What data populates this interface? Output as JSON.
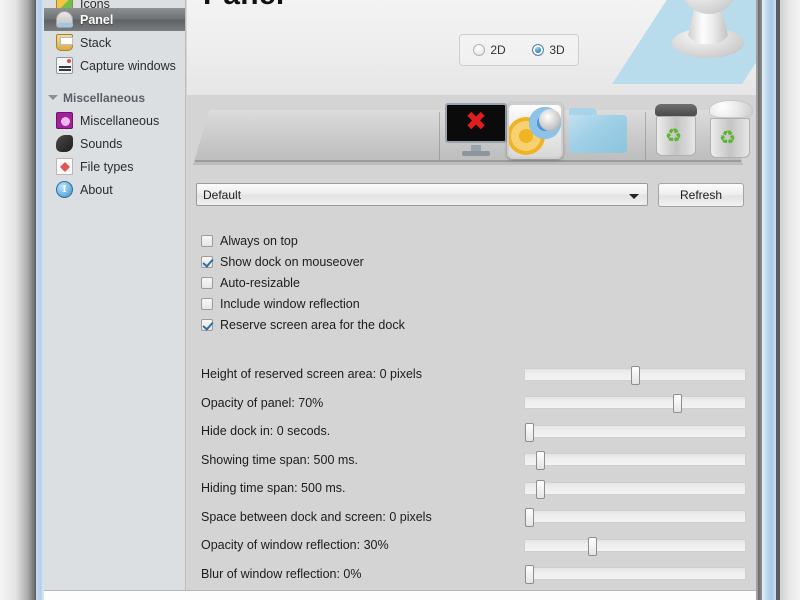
{
  "window": {
    "accent_blue": "#b3cde8",
    "client_bg": "#d4d4d4"
  },
  "sidebar": {
    "items": [
      {
        "label": "Icons",
        "icon": "icons-icon",
        "selected": false,
        "partial": true
      },
      {
        "label": "Panel",
        "icon": "panel-icon",
        "selected": true,
        "partial": false
      },
      {
        "label": "Stack",
        "icon": "stack-icon",
        "selected": false,
        "partial": false
      },
      {
        "label": "Capture windows",
        "icon": "capture-windows-icon",
        "selected": false,
        "partial": false
      }
    ],
    "group": {
      "label": "Miscellaneous",
      "icon": "chevron-down-icon"
    },
    "group_items": [
      {
        "label": "Miscellaneous",
        "icon": "miscellaneous-icon"
      },
      {
        "label": "Sounds",
        "icon": "sounds-icon"
      },
      {
        "label": "File types",
        "icon": "file-types-icon"
      },
      {
        "label": "About",
        "icon": "about-icon"
      }
    ]
  },
  "header": {
    "title": "Panel",
    "mode": {
      "options": [
        {
          "label": "2D",
          "selected": false
        },
        {
          "label": "3D",
          "selected": true
        }
      ]
    }
  },
  "preview": {
    "dock_icons": [
      {
        "name": "monitor-icon"
      },
      {
        "name": "settings-gears-icon"
      },
      {
        "name": "folder-icon"
      },
      {
        "name": "recycle-bin-empty-icon"
      },
      {
        "name": "recycle-bin-full-icon"
      },
      {
        "name": "copy-files-icon"
      },
      {
        "name": "minimize-windows-icon"
      }
    ]
  },
  "theme": {
    "selected": "Default",
    "refresh_label": "Refresh"
  },
  "checkboxes": [
    {
      "label": "Always on top",
      "checked": false
    },
    {
      "label": "Show dock on mouseover",
      "checked": true
    },
    {
      "label": "Auto-resizable",
      "checked": false
    },
    {
      "label": "Include window reflection",
      "checked": false
    },
    {
      "label": "Reserve screen area for the dock",
      "checked": true
    }
  ],
  "sliders": [
    {
      "label": "Height of reserved screen area: 0 pixels",
      "percent": 50
    },
    {
      "label": "Opacity of panel: 70%",
      "percent": 70
    },
    {
      "label": "Hide dock in: 0 secods.",
      "percent": 0
    },
    {
      "label": "Showing time span: 500 ms.",
      "percent": 5
    },
    {
      "label": "Hiding time span: 500 ms.",
      "percent": 5
    },
    {
      "label": "Space between dock and screen: 0 pixels",
      "percent": 0
    },
    {
      "label": "Opacity of window reflection: 30%",
      "percent": 30
    },
    {
      "label": "Blur of window reflection: 0%",
      "percent": 0
    }
  ]
}
